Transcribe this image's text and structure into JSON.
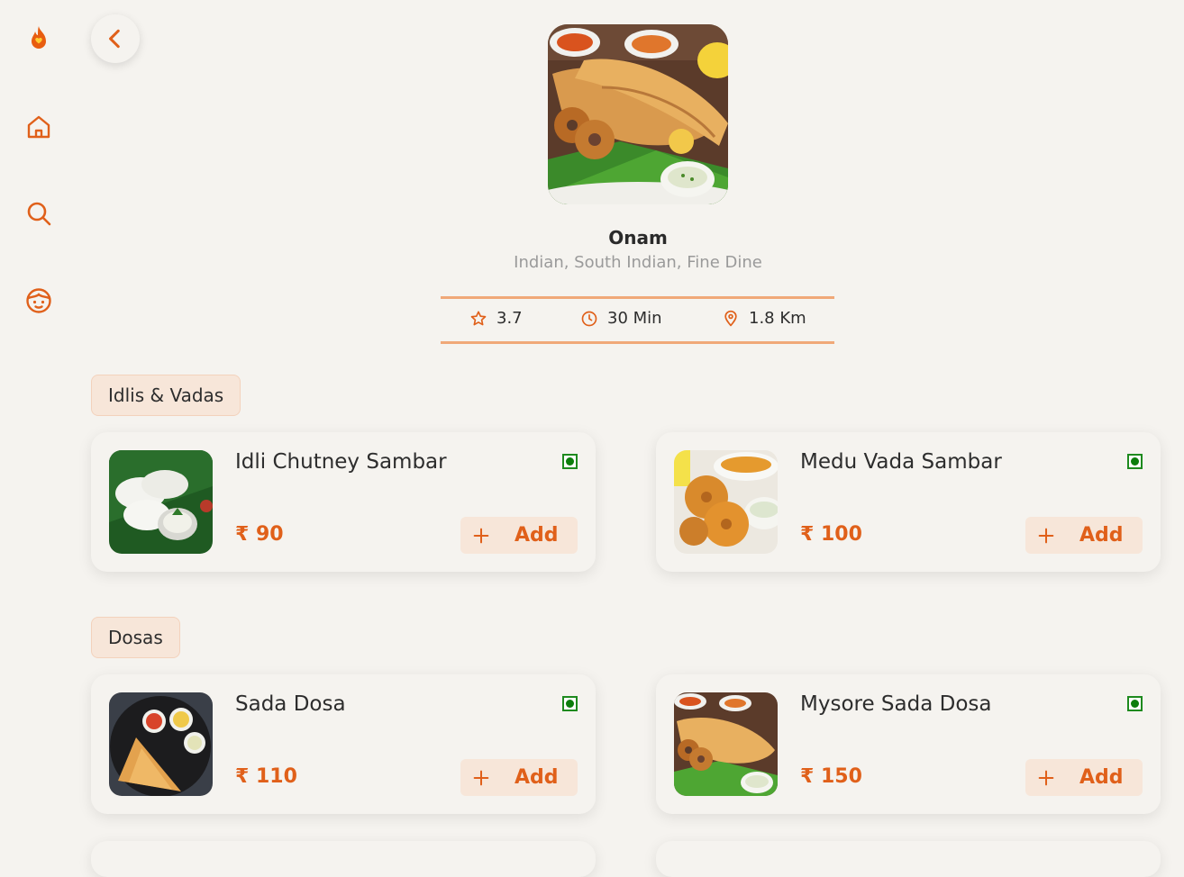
{
  "colors": {
    "accent": "#e0601a",
    "background": "#f5f3ef",
    "chip": "#f7e6d9",
    "veg": "#0c7d0c",
    "muted": "#9a9a9a"
  },
  "sidebar": {
    "items": [
      {
        "icon": "flame-logo-icon"
      },
      {
        "icon": "home-icon"
      },
      {
        "icon": "search-icon"
      },
      {
        "icon": "profile-icon"
      }
    ]
  },
  "restaurant": {
    "name": "Onam",
    "tags": "Indian, South Indian, Fine Dine",
    "rating": "3.7",
    "time": "30 Min",
    "distance": "1.8 Km"
  },
  "menu": [
    {
      "category": "Idlis & Vadas",
      "items": [
        {
          "name": "Idli Chutney Sambar",
          "price": "₹ 90",
          "add": "Add",
          "veg": true
        },
        {
          "name": "Medu Vada Sambar",
          "price": "₹ 100",
          "add": "Add",
          "veg": true
        }
      ]
    },
    {
      "category": "Dosas",
      "items": [
        {
          "name": "Sada Dosa",
          "price": "₹ 110",
          "add": "Add",
          "veg": true
        },
        {
          "name": "Mysore Sada Dosa",
          "price": "₹ 150",
          "add": "Add",
          "veg": true
        }
      ]
    }
  ]
}
